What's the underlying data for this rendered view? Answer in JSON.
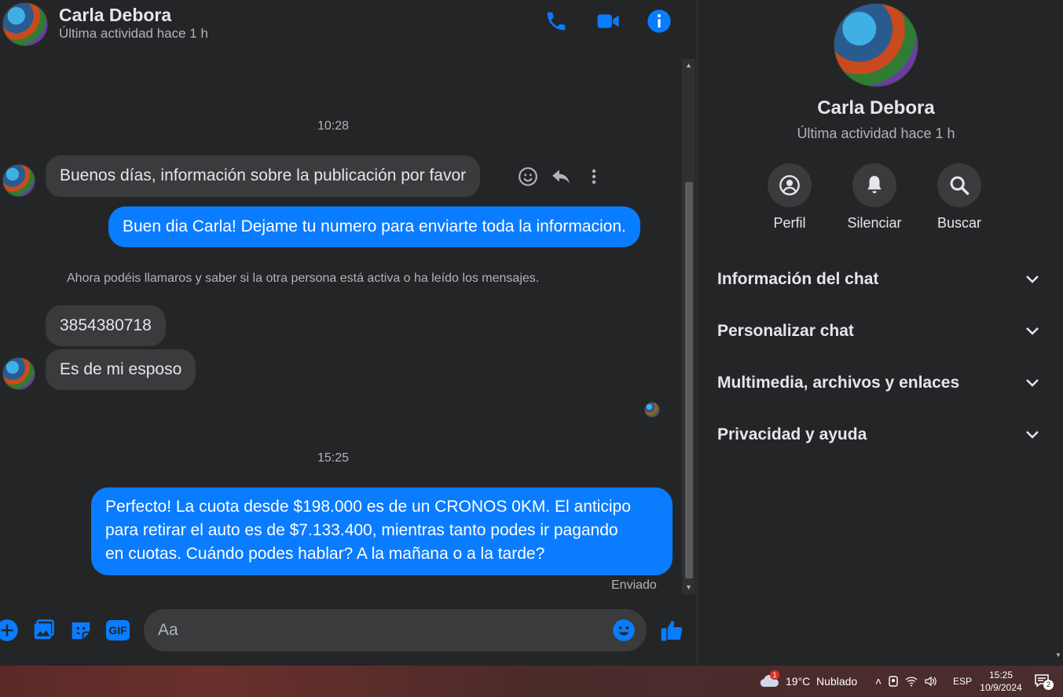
{
  "contact": {
    "name": "Carla Debora",
    "status": "Última actividad hace 1 h"
  },
  "messages": {
    "time1": "10:28",
    "incoming1": "Buenos días, información sobre la publicación por favor",
    "outgoing1": "Buen dia Carla! Dejame tu numero para enviarte toda la informacion.",
    "system_note": "Ahora podéis llamaros y saber si la otra persona está activa o ha leído los mensajes.",
    "incoming2": "3854380718",
    "incoming3": "Es de mi esposo",
    "time2": "15:25",
    "outgoing2_line1": "Perfecto! La cuota desde $198.000 es de un CRONOS 0KM. El anticipo",
    "outgoing2_line2": "para retirar el auto es de $7.133.400, mientras tanto podes ir pagando",
    "outgoing2_line3": "en cuotas. Cuándo podes hablar? A la mañana o a la tarde?",
    "sent_status": "Enviado"
  },
  "composer": {
    "placeholder": "Aa",
    "gif_label": "GIF"
  },
  "info_panel": {
    "actions": [
      "Perfil",
      "Silenciar",
      "Buscar"
    ],
    "sections": [
      "Información del chat",
      "Personalizar chat",
      "Multimedia, archivos y enlaces",
      "Privacidad y ayuda"
    ]
  },
  "taskbar": {
    "weather": "19°C  Nublado",
    "weather_badge": "1",
    "language": "ESP",
    "time": "15:25",
    "date": "10/9/2024",
    "notifications": "2"
  },
  "colors": {
    "accent": "#0a7cff",
    "background": "#242526",
    "bubble_incoming": "#3a3b3c"
  }
}
